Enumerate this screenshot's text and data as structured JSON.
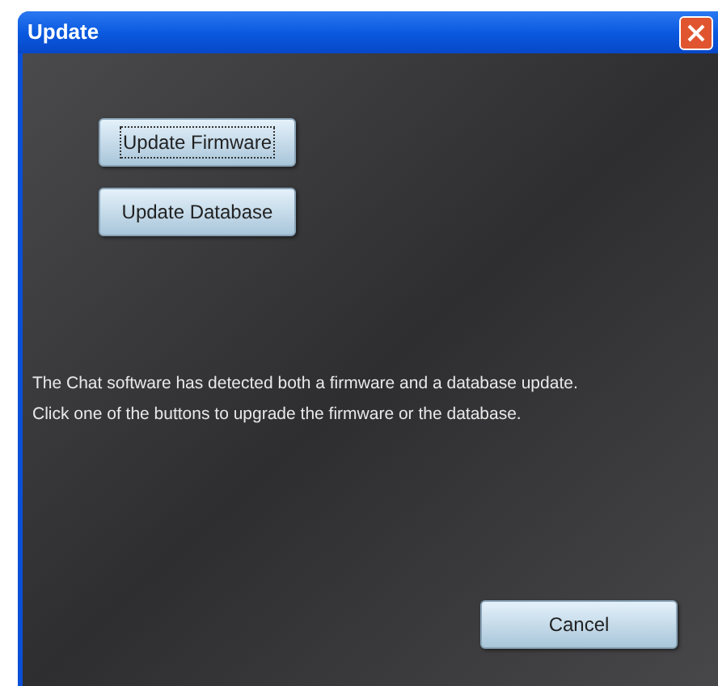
{
  "window": {
    "title": "Update"
  },
  "buttons": [
    {
      "label": "Update Firmware",
      "focused": true
    },
    {
      "label": "Update Database",
      "focused": false
    }
  ],
  "message": [
    "The Chat software has detected both a firmware and a database update.",
    "Click one of the buttons to upgrade the firmware or the database."
  ],
  "cancel": {
    "label": "Cancel"
  }
}
